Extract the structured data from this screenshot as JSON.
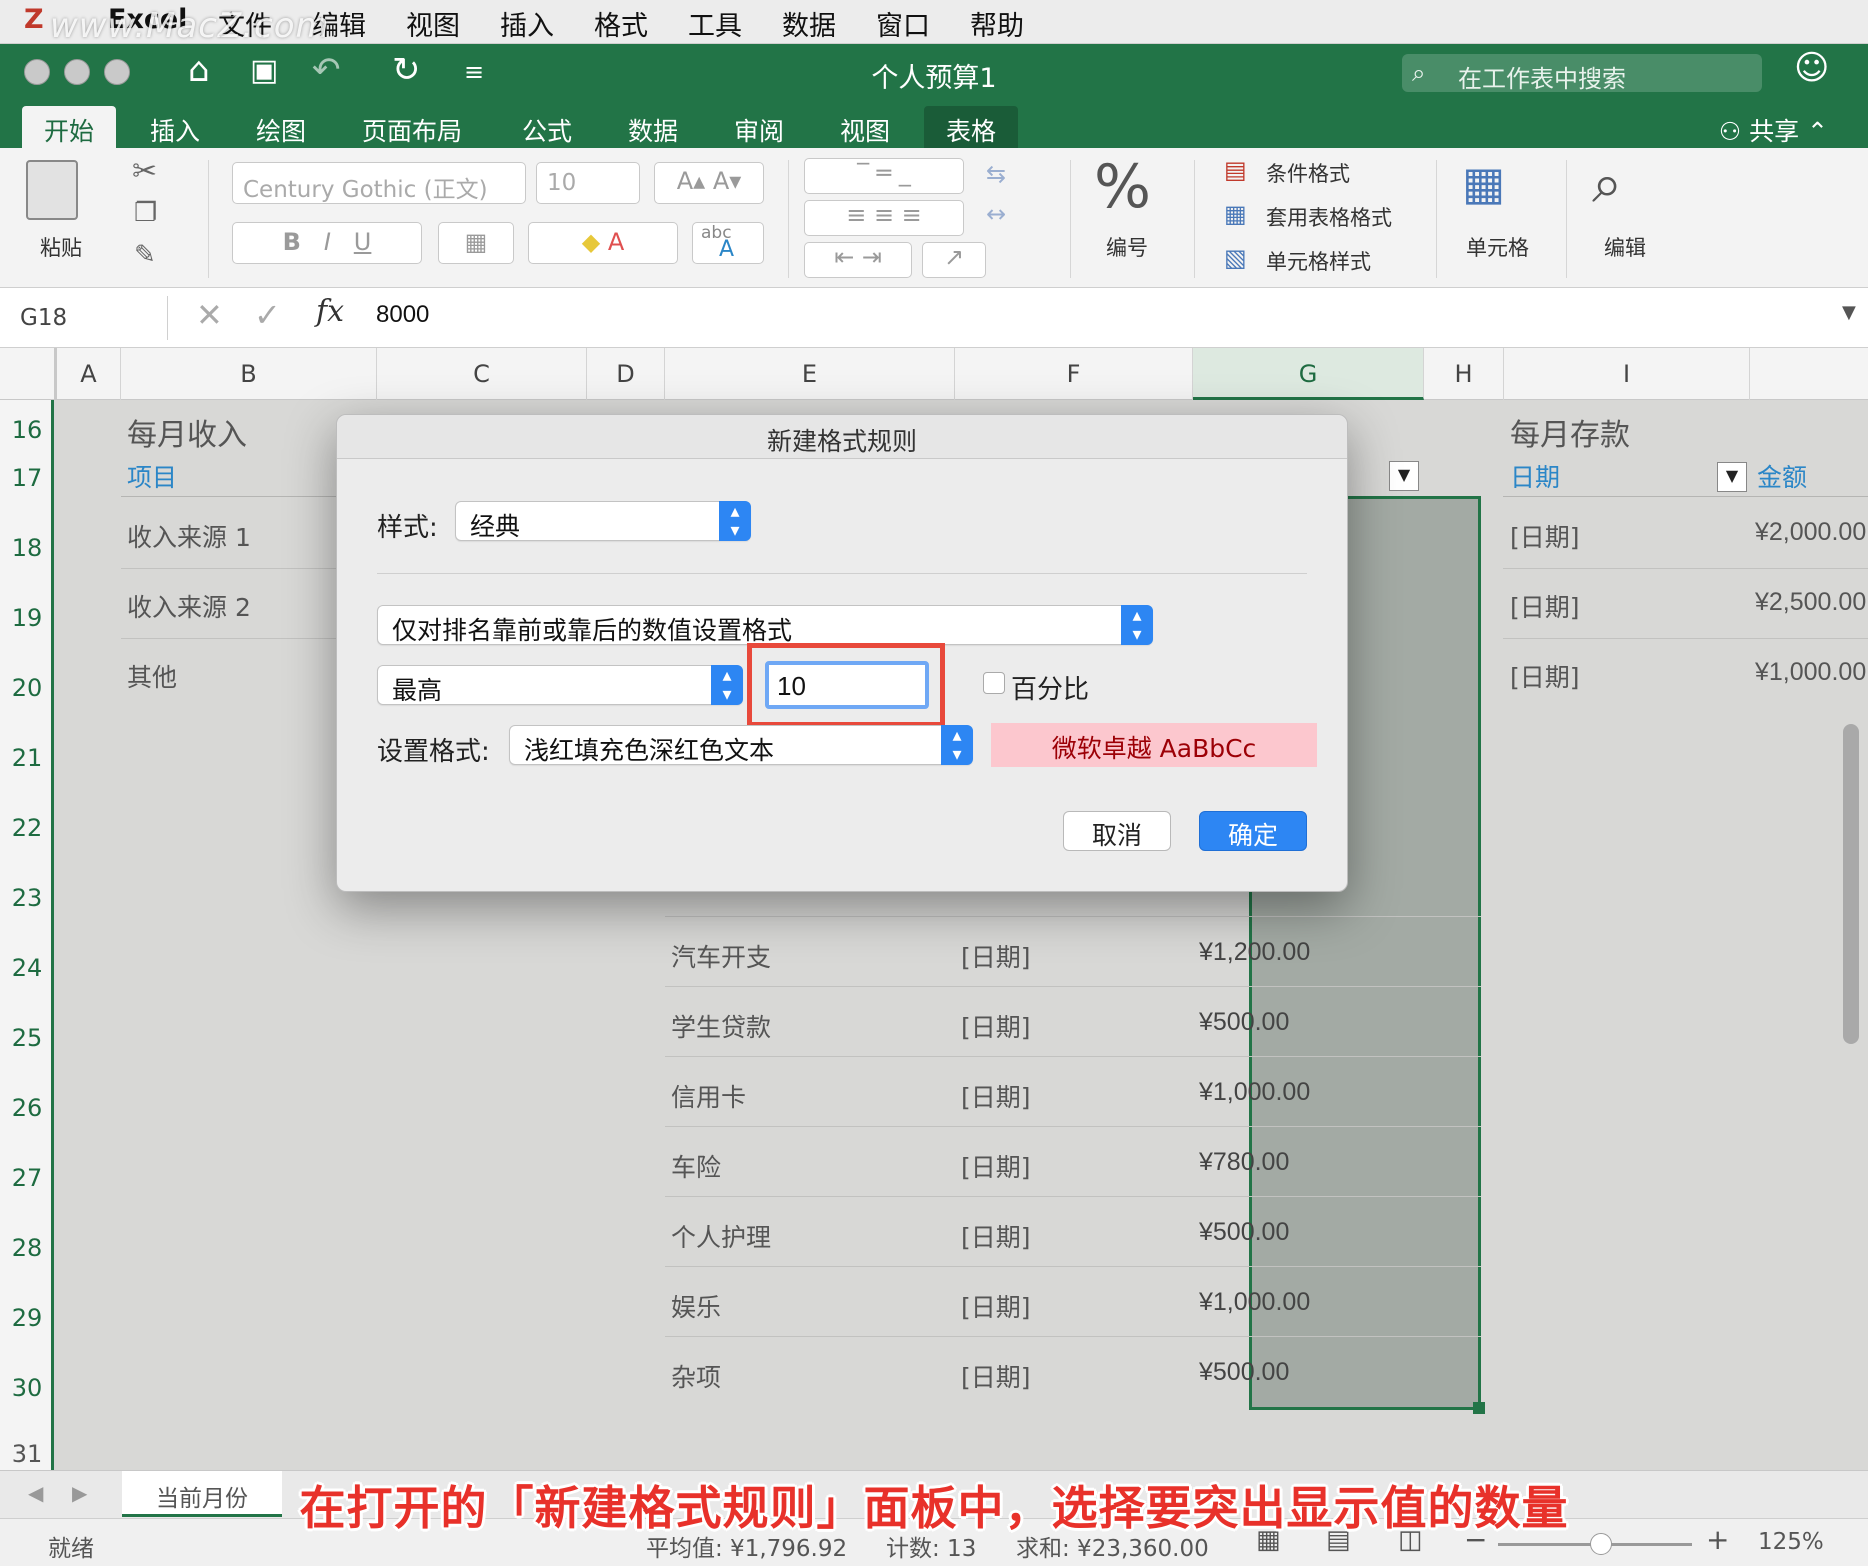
{
  "menubar": {
    "items": [
      "Excel",
      "文件",
      "编辑",
      "视图",
      "插入",
      "格式",
      "工具",
      "数据",
      "窗口",
      "帮助"
    ],
    "watermark": "www.MacZ.com"
  },
  "window": {
    "title": "个人预算1",
    "search_placeholder": "在工作表中搜索",
    "share_label": "共享"
  },
  "ribbon_tabs": [
    "开始",
    "插入",
    "绘图",
    "页面布局",
    "公式",
    "数据",
    "审阅",
    "视图",
    "表格"
  ],
  "ribbon": {
    "paste_label": "粘贴",
    "font_name": "Century Gothic (正文)",
    "font_size": "10",
    "abc_label": "abc",
    "number_label": "编号",
    "conditional_format": "条件格式",
    "table_format": "套用表格格式",
    "cell_style": "单元格样式",
    "cells_label": "单元格",
    "edit_label": "编辑"
  },
  "formula_bar": {
    "name_box": "G18",
    "fx": "fx",
    "value": "8000"
  },
  "columns": [
    "A",
    "B",
    "C",
    "D",
    "E",
    "F",
    "G",
    "H",
    "I"
  ],
  "rows": [
    "16",
    "17",
    "18",
    "19",
    "20",
    "21",
    "22",
    "23",
    "24",
    "25",
    "26",
    "27",
    "28",
    "29",
    "30",
    "31"
  ],
  "income": {
    "title": "每月收入",
    "header": "项目",
    "items": [
      "收入来源 1",
      "收入来源 2",
      "其他"
    ]
  },
  "savings": {
    "title": "每月存款",
    "date_header": "日期",
    "amount_header": "金额",
    "rows": [
      {
        "date": "[日期]",
        "amount": "¥2,000.00"
      },
      {
        "date": "[日期]",
        "amount": "¥2,500.00"
      },
      {
        "date": "[日期]",
        "amount": "¥1,000.00"
      }
    ]
  },
  "expenses": [
    {
      "item": "汽车开支",
      "date": "[日期]",
      "amount": "¥1,200.00"
    },
    {
      "item": "学生贷款",
      "date": "[日期]",
      "amount": "¥500.00"
    },
    {
      "item": "信用卡",
      "date": "[日期]",
      "amount": "¥1,000.00"
    },
    {
      "item": "车险",
      "date": "[日期]",
      "amount": "¥780.00"
    },
    {
      "item": "个人护理",
      "date": "[日期]",
      "amount": "¥500.00"
    },
    {
      "item": "娱乐",
      "date": "[日期]",
      "amount": "¥1,000.00"
    },
    {
      "item": "杂项",
      "date": "[日期]",
      "amount": "¥500.00"
    }
  ],
  "dialog": {
    "title": "新建格式规则",
    "style_label": "样式:",
    "style_value": "经典",
    "rule_type": "仅对排名靠前或靠后的数值设置格式",
    "rank_direction": "最高",
    "rank_count": "10",
    "percent_label": "百分比",
    "format_label": "设置格式:",
    "format_value": "浅红填充色深红色文本",
    "preview_text": "微软卓越  AaBbCc",
    "cancel": "取消",
    "ok": "确定"
  },
  "sheet_tab": "当前月份",
  "status": {
    "ready": "就绪",
    "average": "平均值: ¥1,796.92",
    "count": "计数: 13",
    "sum": "求和: ¥23,360.00",
    "zoom": "125%"
  },
  "caption": "在打开的「新建格式规则」面板中，选择要突出显示值的数量"
}
